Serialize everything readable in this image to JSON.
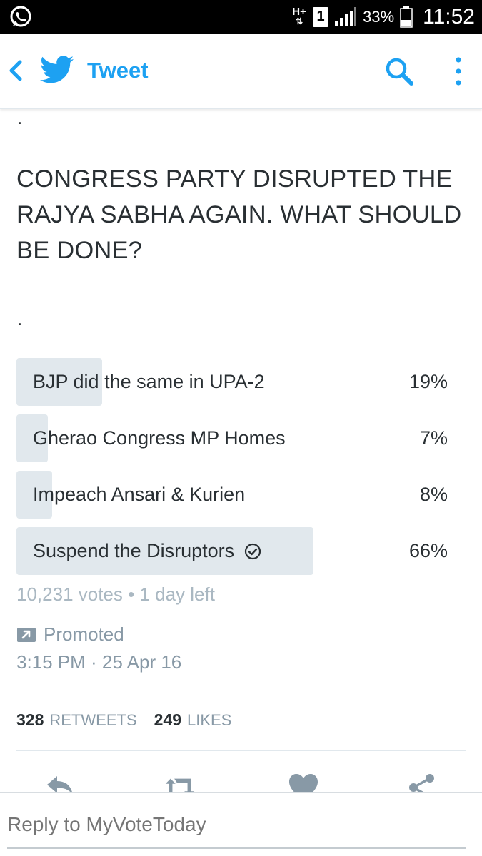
{
  "status_bar": {
    "network": "H+",
    "sim": "1",
    "battery": "33%",
    "time": "11:52",
    "icons": [
      "whatsapp-icon",
      "network-icon",
      "sim-icon",
      "signal-icon",
      "battery-icon"
    ]
  },
  "nav": {
    "title": "Tweet",
    "icons": [
      "back-icon",
      "twitter-bird-icon",
      "search-icon",
      "more-vert-icon"
    ]
  },
  "tweet": {
    "dot_top": ".",
    "question": "CONGRESS PARTY DISRUPTED THE RAJYA SABHA AGAIN. WHAT SHOULD BE DONE?",
    "dot_bottom": ".",
    "poll": {
      "options": [
        {
          "label": "BJP did the same in UPA-2",
          "percent": "19%",
          "fraction": 0.19,
          "winner": false
        },
        {
          "label": "Gherao Congress MP Homes",
          "percent": "7%",
          "fraction": 0.07,
          "winner": false
        },
        {
          "label": "Impeach Ansari & Kurien",
          "percent": "8%",
          "fraction": 0.08,
          "winner": false
        },
        {
          "label": "Suspend the Disruptors",
          "percent": "66%",
          "fraction": 0.66,
          "winner": true
        }
      ],
      "summary": "10,231 votes • 1 day left"
    },
    "promoted": "Promoted",
    "timestamp": "3:15 PM · 25 Apr 16",
    "retweets_count": "328",
    "retweets_label": "RETWEETS",
    "likes_count": "249",
    "likes_label": "LIKES"
  },
  "actions": [
    "reply-icon",
    "retweet-icon",
    "like-icon",
    "share-icon"
  ],
  "reply": {
    "placeholder": "Reply to MyVoteToday"
  },
  "colors": {
    "twitter_blue": "#1da1f2",
    "poll_fill": "#e1e8ed",
    "muted_text": "#8899a6",
    "icon_gray": "#8899a6"
  }
}
